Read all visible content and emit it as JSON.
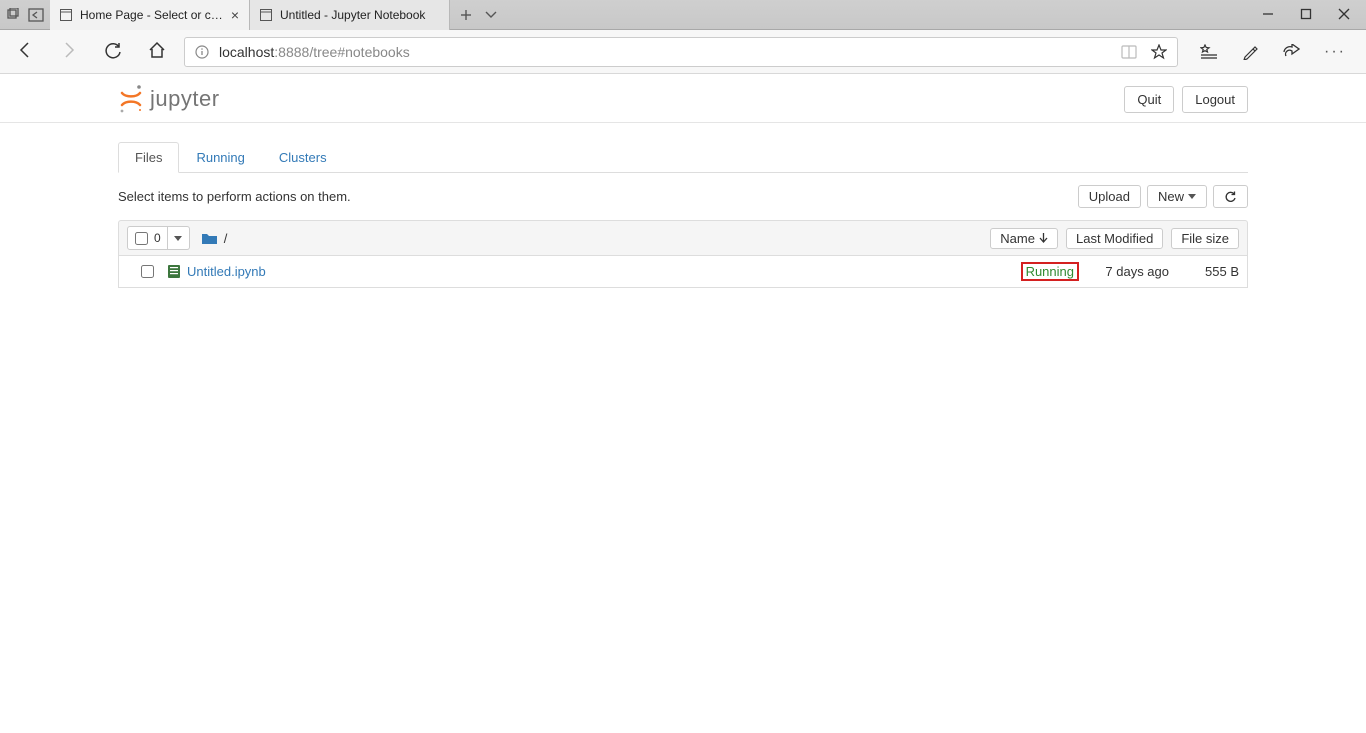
{
  "browser": {
    "tabs": [
      {
        "title": "Home Page - Select or create a notebook"
      },
      {
        "title": "Untitled - Jupyter Notebook"
      }
    ],
    "url": {
      "host": "localhost",
      "port": ":8888",
      "path": "/tree#notebooks"
    }
  },
  "jupyter": {
    "brand": "jupyter",
    "header_buttons": {
      "quit": "Quit",
      "logout": "Logout"
    },
    "tabs": {
      "files": "Files",
      "running": "Running",
      "clusters": "Clusters"
    },
    "action_text": "Select items to perform actions on them.",
    "toolbar": {
      "upload": "Upload",
      "new": "New",
      "refresh_title": "Refresh file list"
    },
    "list_header": {
      "selected_count": "0",
      "breadcrumb_root": "/",
      "name": "Name",
      "last_modified": "Last Modified",
      "file_size": "File size"
    },
    "items": [
      {
        "name": "Untitled.ipynb",
        "status": "Running",
        "date": "7 days ago",
        "size": "555 B"
      }
    ]
  }
}
